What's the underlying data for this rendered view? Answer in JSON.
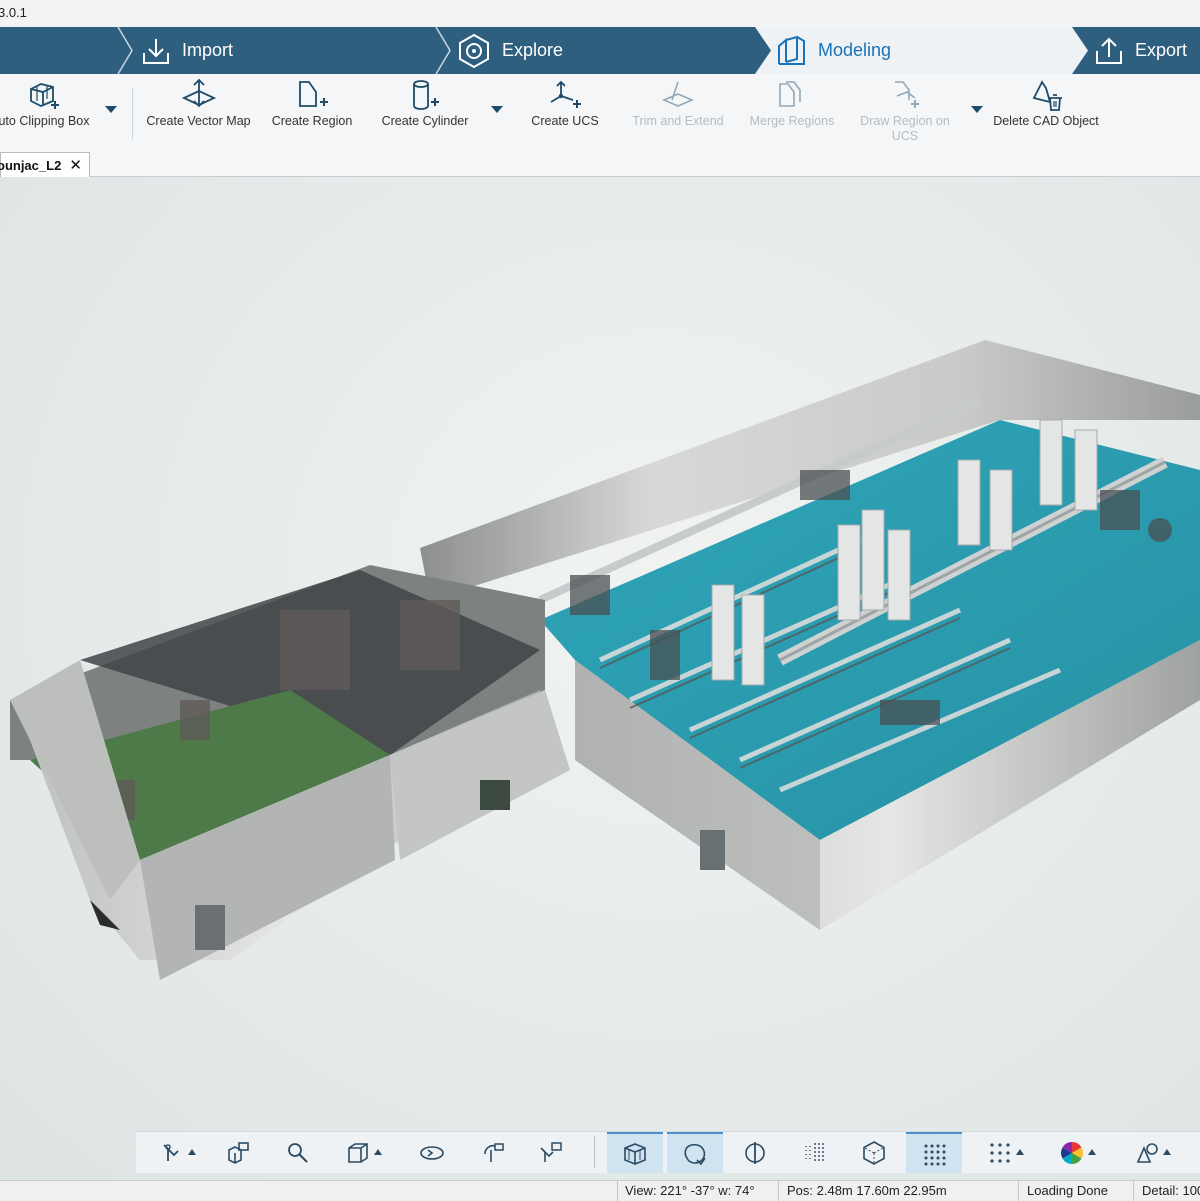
{
  "app": {
    "version_text": "3.0.1"
  },
  "stages": [
    {
      "label": "Import",
      "icon": "import-icon"
    },
    {
      "label": "Explore",
      "icon": "explore-icon"
    },
    {
      "label": "Modeling",
      "icon": "modeling-icon",
      "active": true
    },
    {
      "label": "Export",
      "icon": "export-icon"
    }
  ],
  "ribbon": {
    "tools": [
      {
        "label": "uto Clipping Box",
        "icon": "clipping-box-icon",
        "enabled": true
      },
      {
        "label": "Create Vector Map",
        "icon": "vector-map-icon",
        "enabled": true
      },
      {
        "label": "Create Region",
        "icon": "region-icon",
        "enabled": true
      },
      {
        "label": "Create Cylinder",
        "icon": "cylinder-icon",
        "enabled": true
      },
      {
        "label": "Create UCS",
        "icon": "ucs-icon",
        "enabled": true
      },
      {
        "label": "Trim and Extend",
        "icon": "trim-extend-icon",
        "enabled": false
      },
      {
        "label": "Merge Regions",
        "icon": "merge-regions-icon",
        "enabled": false
      },
      {
        "label": "Draw Region on",
        "label2": "UCS",
        "icon": "draw-region-ucs-icon",
        "enabled": false
      },
      {
        "label": "Delete CAD Object",
        "icon": "delete-cad-icon",
        "enabled": true
      }
    ]
  },
  "tab": {
    "name": "ounjac_L2",
    "close": "✕"
  },
  "navbar": {
    "buttons": [
      {
        "icon": "select-tool-icon",
        "dropdown": true
      },
      {
        "icon": "fit-view-icon"
      },
      {
        "icon": "zoom-icon"
      },
      {
        "icon": "cube-view-icon",
        "dropdown": true
      },
      {
        "icon": "orbit-icon"
      },
      {
        "icon": "rotate-camera-icon"
      },
      {
        "icon": "walk-camera-icon"
      },
      {
        "icon": "clipping-box-view-icon",
        "active": true
      },
      {
        "icon": "point-cloud-toggle-icon",
        "active": true
      },
      {
        "icon": "section-icon"
      },
      {
        "icon": "grid-density-icon"
      },
      {
        "icon": "hexagon-volume-icon"
      },
      {
        "icon": "point-density-icon",
        "active": true
      },
      {
        "icon": "point-size-icon",
        "dropdown": true
      },
      {
        "icon": "color-wheel-icon",
        "dropdown": true
      },
      {
        "icon": "shapes-icon",
        "dropdown": true
      }
    ]
  },
  "status": {
    "view": "View: 221° -37° w: 74°",
    "pos": "Pos: 2.48m 17.60m 22.95m",
    "loading": "Loading Done",
    "detail": "Detail: 100"
  },
  "colors": {
    "stage_bar": "#2f5f7f",
    "active_stage_bg": "#eef2f4",
    "accent": "#1a73b8",
    "floor_teal": "#2b9fb3",
    "floor_green": "#4e7a4a"
  }
}
